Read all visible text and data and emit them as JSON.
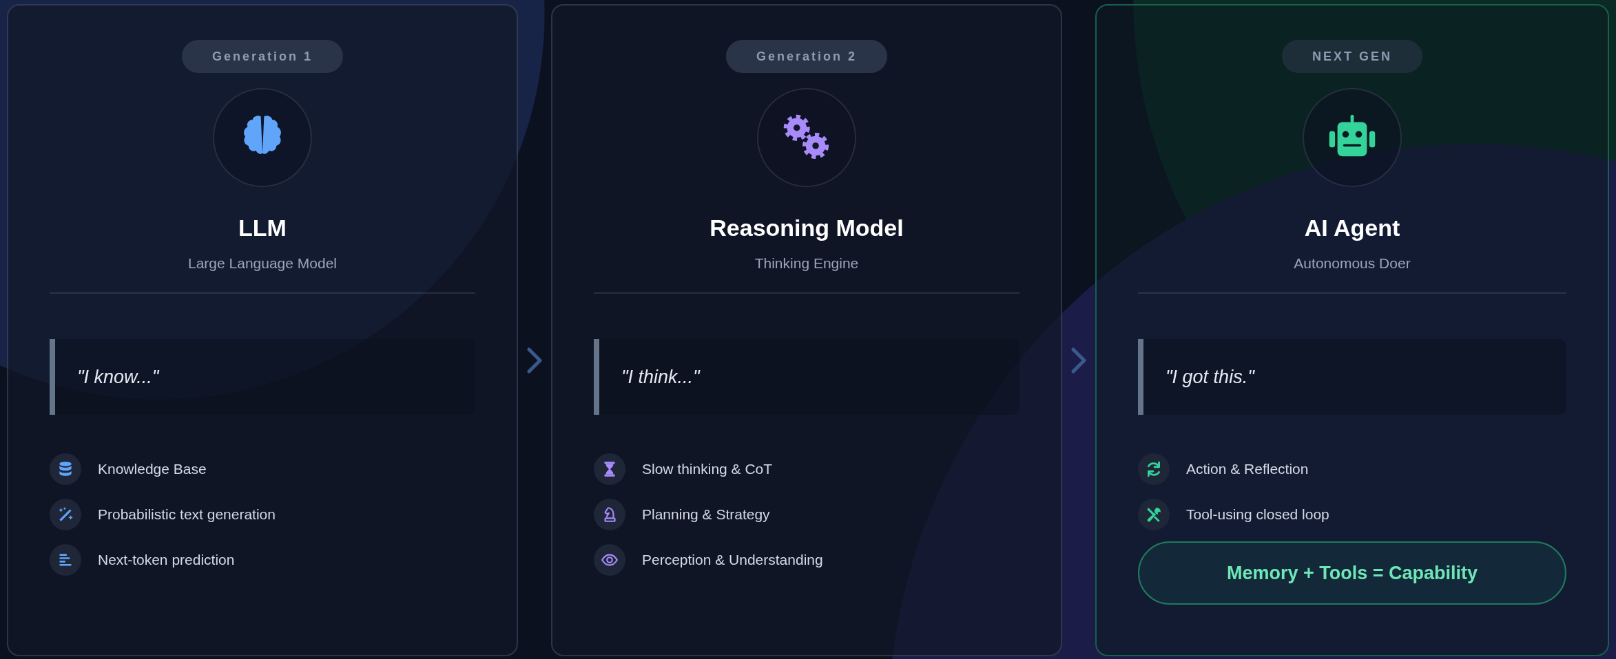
{
  "cards": [
    {
      "badge": "Generation 1",
      "title": "LLM",
      "subtitle": "Large Language Model",
      "quote": "\"I know...\"",
      "color": "#60a5fa",
      "highlighted": false,
      "features": [
        "Knowledge Base",
        "Probabilistic text generation",
        "Next-token prediction"
      ]
    },
    {
      "badge": "Generation 2",
      "title": "Reasoning Model",
      "subtitle": "Thinking Engine",
      "quote": "\"I think...\"",
      "color": "#a78bfa",
      "highlighted": false,
      "features": [
        "Slow thinking & CoT",
        "Planning & Strategy",
        "Perception & Understanding"
      ]
    },
    {
      "badge": "NEXT GEN",
      "title": "AI Agent",
      "subtitle": "Autonomous Doer",
      "quote": "\"I got this.\"",
      "color": "#34d399",
      "highlighted": true,
      "features": [
        "Action & Reflection",
        "Tool-using closed loop"
      ],
      "footer": "Memory + Tools = Capability"
    }
  ]
}
